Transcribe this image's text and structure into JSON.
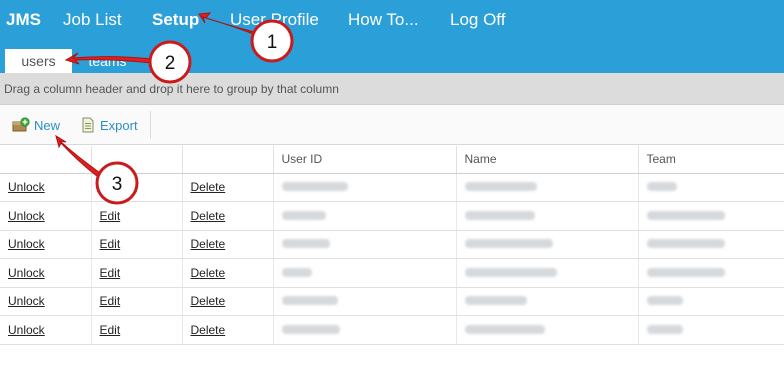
{
  "nav": {
    "brand": "JMS",
    "job_list": "Job List",
    "setup": "Setup",
    "user_profile": "User Profile",
    "how_to": "How To...",
    "log_off": "Log Off"
  },
  "tabs": {
    "users": "users",
    "teams": "teams"
  },
  "group_hint": "Drag a column header and drop it here to group by that column",
  "toolbar": {
    "new_label": "New",
    "export_label": "Export"
  },
  "table": {
    "headers": [
      "",
      "",
      "",
      "User ID",
      "Name",
      "Team"
    ],
    "rows": [
      {
        "unlock": "Unlock",
        "edit": "",
        "delete": "Delete"
      },
      {
        "unlock": "Unlock",
        "edit": "Edit",
        "delete": "Delete"
      },
      {
        "unlock": "Unlock",
        "edit": "Edit",
        "delete": "Delete"
      },
      {
        "unlock": "Unlock",
        "edit": "Edit",
        "delete": "Delete"
      },
      {
        "unlock": "Unlock",
        "edit": "Edit",
        "delete": "Delete"
      },
      {
        "unlock": "Unlock",
        "edit": "Edit",
        "delete": "Delete"
      }
    ]
  },
  "callouts": [
    "1",
    "2",
    "3"
  ],
  "colors": {
    "topbar": "#2a9fd8",
    "callout_arrow": "#e02020",
    "link": "#2a8fc8"
  }
}
